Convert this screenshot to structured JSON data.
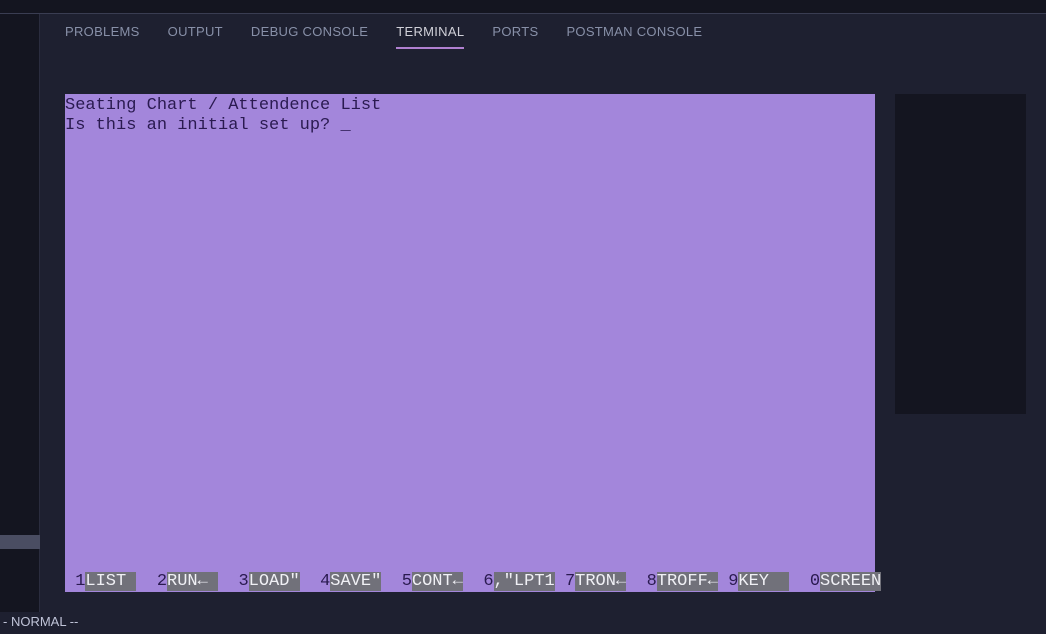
{
  "panel_tabs": {
    "problems": "PROBLEMS",
    "output": "OUTPUT",
    "debug_console": "DEBUG CONSOLE",
    "terminal": "TERMINAL",
    "ports": "PORTS",
    "postman_console": "POSTMAN CONSOLE"
  },
  "terminal": {
    "line1": "Seating Chart / Attendence List",
    "line2": "Is this an initial set up? ",
    "cursor": "_"
  },
  "function_keys": [
    {
      "num": " 1",
      "label": "LIST "
    },
    {
      "num": "  2",
      "label": "RUN← "
    },
    {
      "num": "  3",
      "label": "LOAD\""
    },
    {
      "num": "  4",
      "label": "SAVE\""
    },
    {
      "num": "  5",
      "label": "CONT←"
    },
    {
      "num": "  6",
      "label": ",\"LPT1"
    },
    {
      "num": " 7",
      "label": "TRON←"
    },
    {
      "num": "  8",
      "label": "TROFF←"
    },
    {
      "num": " 9",
      "label": "KEY  "
    },
    {
      "num": "  0",
      "label": "SCREEN"
    }
  ],
  "status_bar": {
    "mode": "- NORMAL --"
  }
}
